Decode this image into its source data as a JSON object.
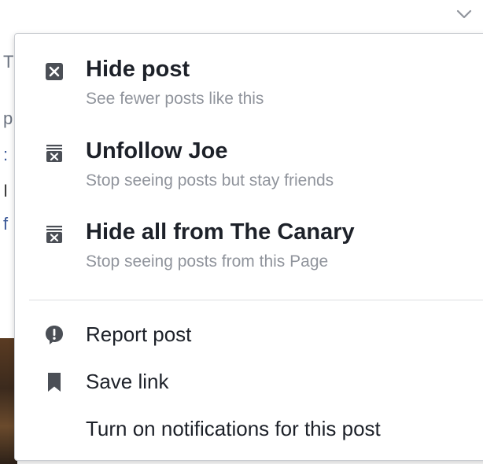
{
  "menu": {
    "primary_items": [
      {
        "icon": "close-box-icon",
        "title": "Hide post",
        "subtitle": "See fewer posts like this"
      },
      {
        "icon": "unfollow-icon",
        "title": "Unfollow Joe",
        "subtitle": "Stop seeing posts but stay friends"
      },
      {
        "icon": "unfollow-icon",
        "title": "Hide all from The Canary",
        "subtitle": "Stop seeing posts from this Page"
      }
    ],
    "secondary_items": [
      {
        "icon": "report-icon",
        "label": "Report post"
      },
      {
        "icon": "bookmark-icon",
        "label": "Save link"
      },
      {
        "icon": "",
        "label": "Turn on notifications for this post"
      }
    ]
  },
  "background": {
    "glyphs": [
      "T",
      "p",
      ":",
      "I",
      "f"
    ]
  },
  "colors": {
    "title_text": "#1d2129",
    "subtitle_text": "#90949c",
    "icon": "#4b4f56",
    "divider": "#dddfe2",
    "menu_border": "#c9ccd1"
  }
}
